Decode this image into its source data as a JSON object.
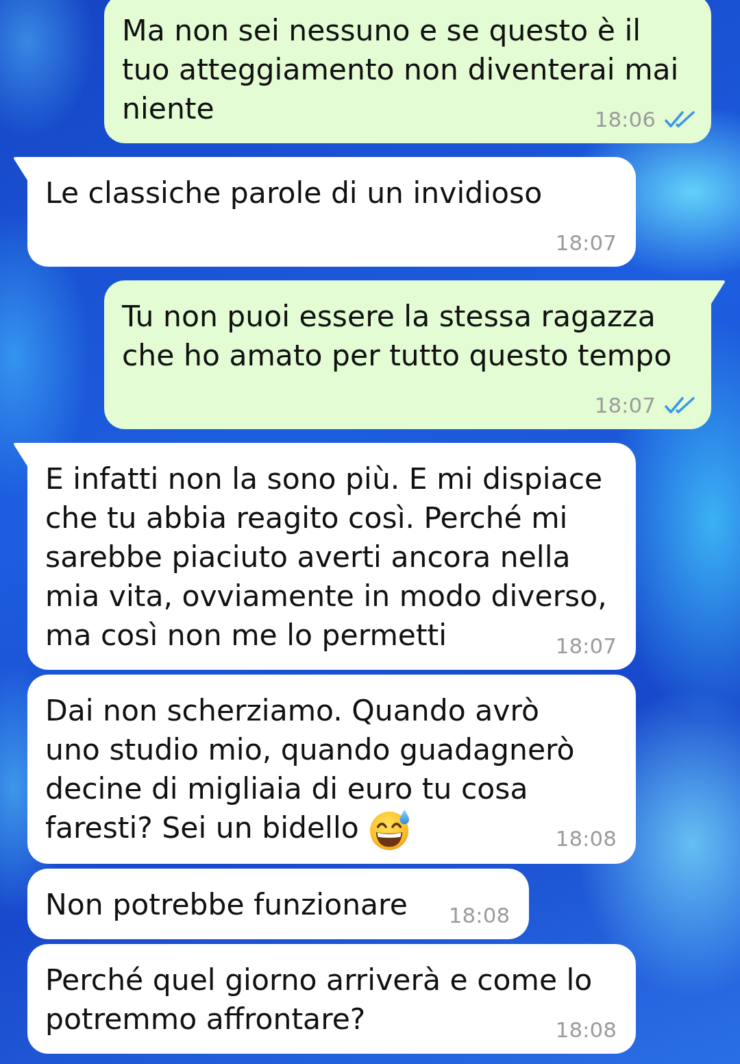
{
  "messages": [
    {
      "kind": "sent",
      "tail": false,
      "lines": [
        "Ma non sei nessuno e se questo è il",
        "tuo atteggiamento non diventerai mai",
        "niente"
      ],
      "emoji": false,
      "time": "18:06",
      "read": true
    },
    {
      "kind": "received",
      "tail": true,
      "lines": [
        "Le classiche parole di un invidioso"
      ],
      "emoji": false,
      "time": "18:07"
    },
    {
      "kind": "sent",
      "tail": true,
      "lines": [
        "Tu non puoi essere la stessa ragazza",
        "che ho amato per tutto questo tempo"
      ],
      "emoji": false,
      "time": "18:07",
      "read": true
    },
    {
      "kind": "received",
      "tail": true,
      "lines": [
        "E infatti non la sono più. E mi dispiace",
        "che tu abbia reagito così. Perché mi",
        "sarebbe piaciuto averti ancora nella",
        "mia vita, ovviamente in modo diverso,",
        "ma così non me lo permetti"
      ],
      "emoji": false,
      "time": "18:07"
    },
    {
      "kind": "received",
      "tail": false,
      "lines": [
        "Dai non scherziamo. Quando avrò",
        "uno studio mio, quando guadagnerò",
        "decine di migliaia di euro tu cosa",
        "faresti? Sei un bidello"
      ],
      "emoji": true,
      "time": "18:08"
    },
    {
      "kind": "received",
      "tail": false,
      "lines": [
        "Non potrebbe funzionare"
      ],
      "emoji": false,
      "time": "18:08"
    },
    {
      "kind": "received",
      "tail": false,
      "lines": [
        "Perché quel giorno arriverà e come lo",
        "potremmo affrontare?"
      ],
      "emoji": false,
      "time": "18:08"
    }
  ]
}
